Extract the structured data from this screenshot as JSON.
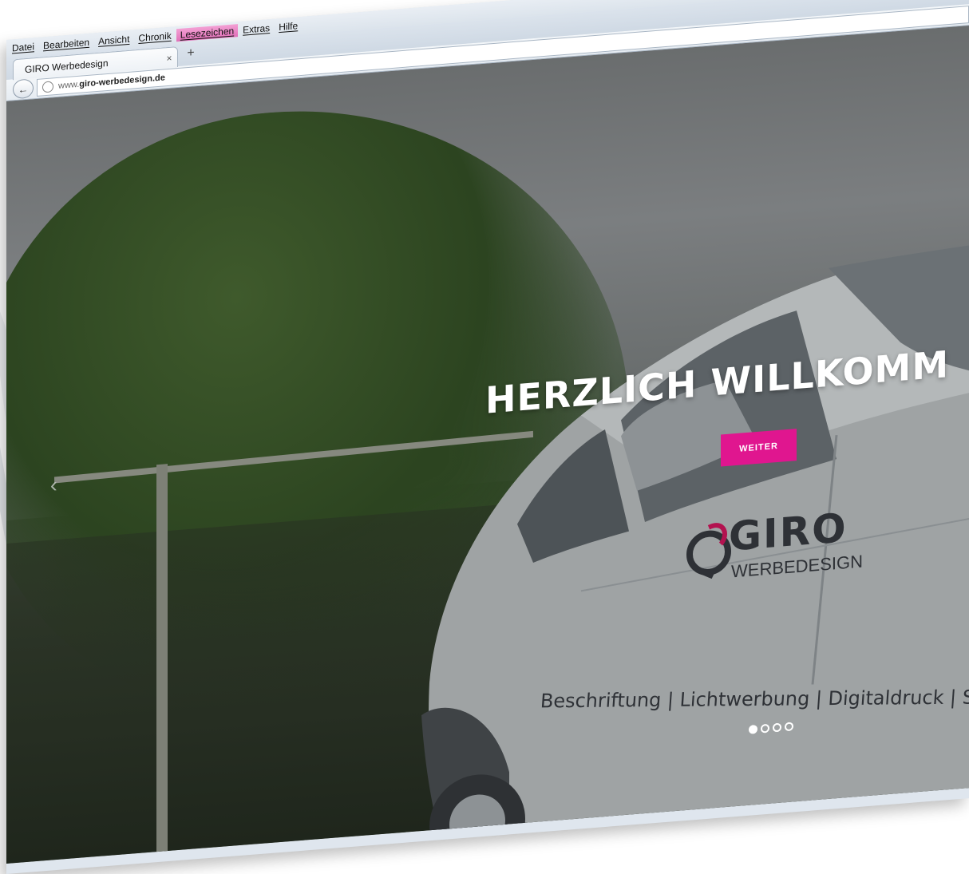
{
  "menubar": {
    "items": [
      {
        "label": "Datei"
      },
      {
        "label": "Bearbeiten"
      },
      {
        "label": "Ansicht"
      },
      {
        "label": "Chronik"
      },
      {
        "label": "Lesezeichen"
      },
      {
        "label": "Extras"
      },
      {
        "label": "Hilfe"
      }
    ],
    "highlighted_item": "Lesezeichen",
    "highlight_color": "#e070b8"
  },
  "tabs": [
    {
      "title": "GIRO Werbedesign",
      "close_icon": "×"
    }
  ],
  "new_tab_icon": "+",
  "navbar": {
    "back_icon": "←",
    "url_prefix": "www.",
    "url_host": "giro-werbedesign.de"
  },
  "hero": {
    "title": "HERZLICH WILLKOMM",
    "button_label": "WEITER",
    "button_color": "#e0168f",
    "prev_icon": "‹",
    "slide_count": 4,
    "active_slide": 1
  },
  "car_branding": {
    "brand_name": "GIRO",
    "brand_subtitle": "WERBEDESIGN",
    "services": "Beschriftung | Lichtwerbung | Digitaldruck | Schilder"
  }
}
